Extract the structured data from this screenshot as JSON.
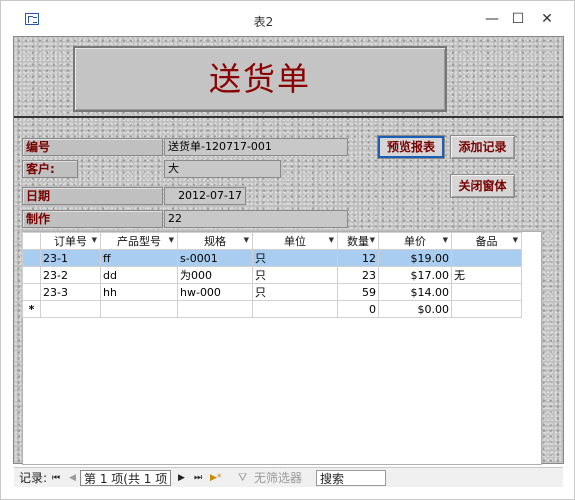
{
  "window": {
    "title": "表2",
    "minimize": "—",
    "maximize": "☐",
    "close": "✕"
  },
  "form": {
    "header_title": "送货单",
    "fields": {
      "number_label": "编号",
      "number_value": "送货单-120717-001",
      "customer_label": "客户:",
      "customer_value": "大",
      "date_label": "日期",
      "date_value": "2012-07-17",
      "maker_label": "制作",
      "maker_value": "22"
    },
    "buttons": {
      "preview": "预览报表",
      "add_record": "添加记录",
      "close_window": "关闭窗体"
    }
  },
  "datasheet": {
    "columns": [
      "订单号",
      "产品型号",
      "规格",
      "单位",
      "数量",
      "单价",
      "备品"
    ],
    "rows": [
      {
        "order": "23-1",
        "model": "ff",
        "spec": "s-0001",
        "unit": "只",
        "qty": "12",
        "price": "$19.00",
        "spare": ""
      },
      {
        "order": "23-2",
        "model": "dd",
        "spec": "为000",
        "unit": "只",
        "qty": "23",
        "price": "$17.00",
        "spare": "无"
      },
      {
        "order": "23-3",
        "model": "hh",
        "spec": "hw-000",
        "unit": "只",
        "qty": "59",
        "price": "$14.00",
        "spare": ""
      }
    ],
    "new_row": {
      "marker": "*",
      "qty": "0",
      "price": "$0.00"
    }
  },
  "navigation": {
    "record_label": "记录:",
    "first": "⏮",
    "prev": "◀",
    "position": "第 1 项(共 1 项",
    "next": "▶",
    "last": "⏭",
    "new": "▶*",
    "filter": "无筛选器",
    "search_placeholder": "搜索"
  }
}
